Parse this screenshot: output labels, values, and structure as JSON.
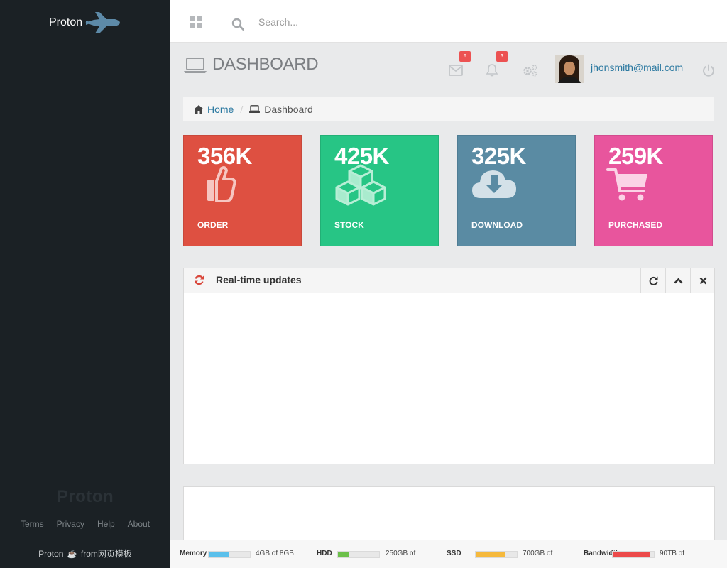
{
  "sidebar": {
    "brand": "Proton",
    "footer_logo": "Proton",
    "links": [
      "Terms",
      "Privacy",
      "Help",
      "About"
    ],
    "credit_brand": "Proton",
    "credit_from": "from",
    "credit_site": "网页模板"
  },
  "topbar": {
    "search_placeholder": "Search..."
  },
  "header": {
    "title": "DASHBOARD",
    "mail_badge": "5",
    "notif_badge": "3",
    "user_email": "jhonsmith@mail.com"
  },
  "breadcrumb": {
    "home": "Home",
    "current": "Dashboard"
  },
  "tiles": [
    {
      "value": "356K",
      "label": "ORDER",
      "icon": "thumbs-up-icon",
      "color": "#de5041"
    },
    {
      "value": "425K",
      "label": "STOCK",
      "icon": "cubes-icon",
      "color": "#27c585"
    },
    {
      "value": "325K",
      "label": "DOWNLOAD",
      "icon": "cloud-download-icon",
      "color": "#5a8ba3"
    },
    {
      "value": "259K",
      "label": "PURCHASED",
      "icon": "shopping-cart-icon",
      "color": "#e8559d"
    }
  ],
  "panel": {
    "title": "Real-time updates"
  },
  "status": [
    {
      "name": "Memory",
      "value": "4GB of 8GB",
      "fill": 0.5,
      "color": "#5bc0eb"
    },
    {
      "name": "HDD",
      "value": "250GB of",
      "fill": 0.25,
      "color": "#6cc04a"
    },
    {
      "name": "SSD",
      "value": "700GB of",
      "fill": 0.7,
      "color": "#f5b93d"
    },
    {
      "name": "Bandwidth",
      "value": "90TB of",
      "fill": 0.9,
      "color": "#ec4a4a"
    }
  ]
}
